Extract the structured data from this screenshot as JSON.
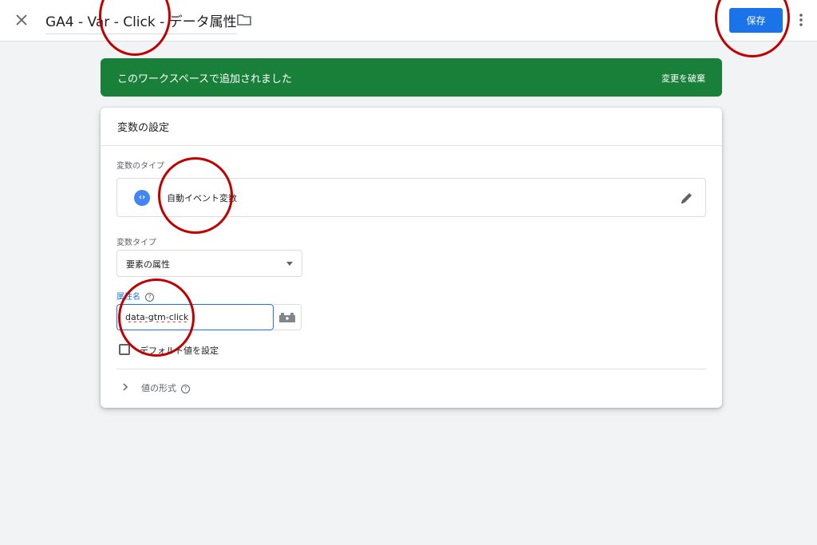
{
  "header": {
    "title": "GA4 - Var - Click - データ属性",
    "save_label": "保存"
  },
  "banner": {
    "message": "このワークスペースで追加されました",
    "discard_label": "変更を破棄",
    "color": "#188038"
  },
  "card": {
    "title": "変数の設定",
    "variable_type_label": "変数のタイプ",
    "variable_type_value": "自動イベント変数",
    "variable_type_icon": "code-brackets-icon",
    "subtype_label": "変数タイプ",
    "subtype_value": "要素の属性",
    "attribute_label": "属性名",
    "attribute_value": "data-gtm-click",
    "default_checkbox_label": "デフォルト値を設定",
    "format_label": "値の形式"
  },
  "colors": {
    "accent": "#1a73e8",
    "annotation": "#c00000"
  }
}
